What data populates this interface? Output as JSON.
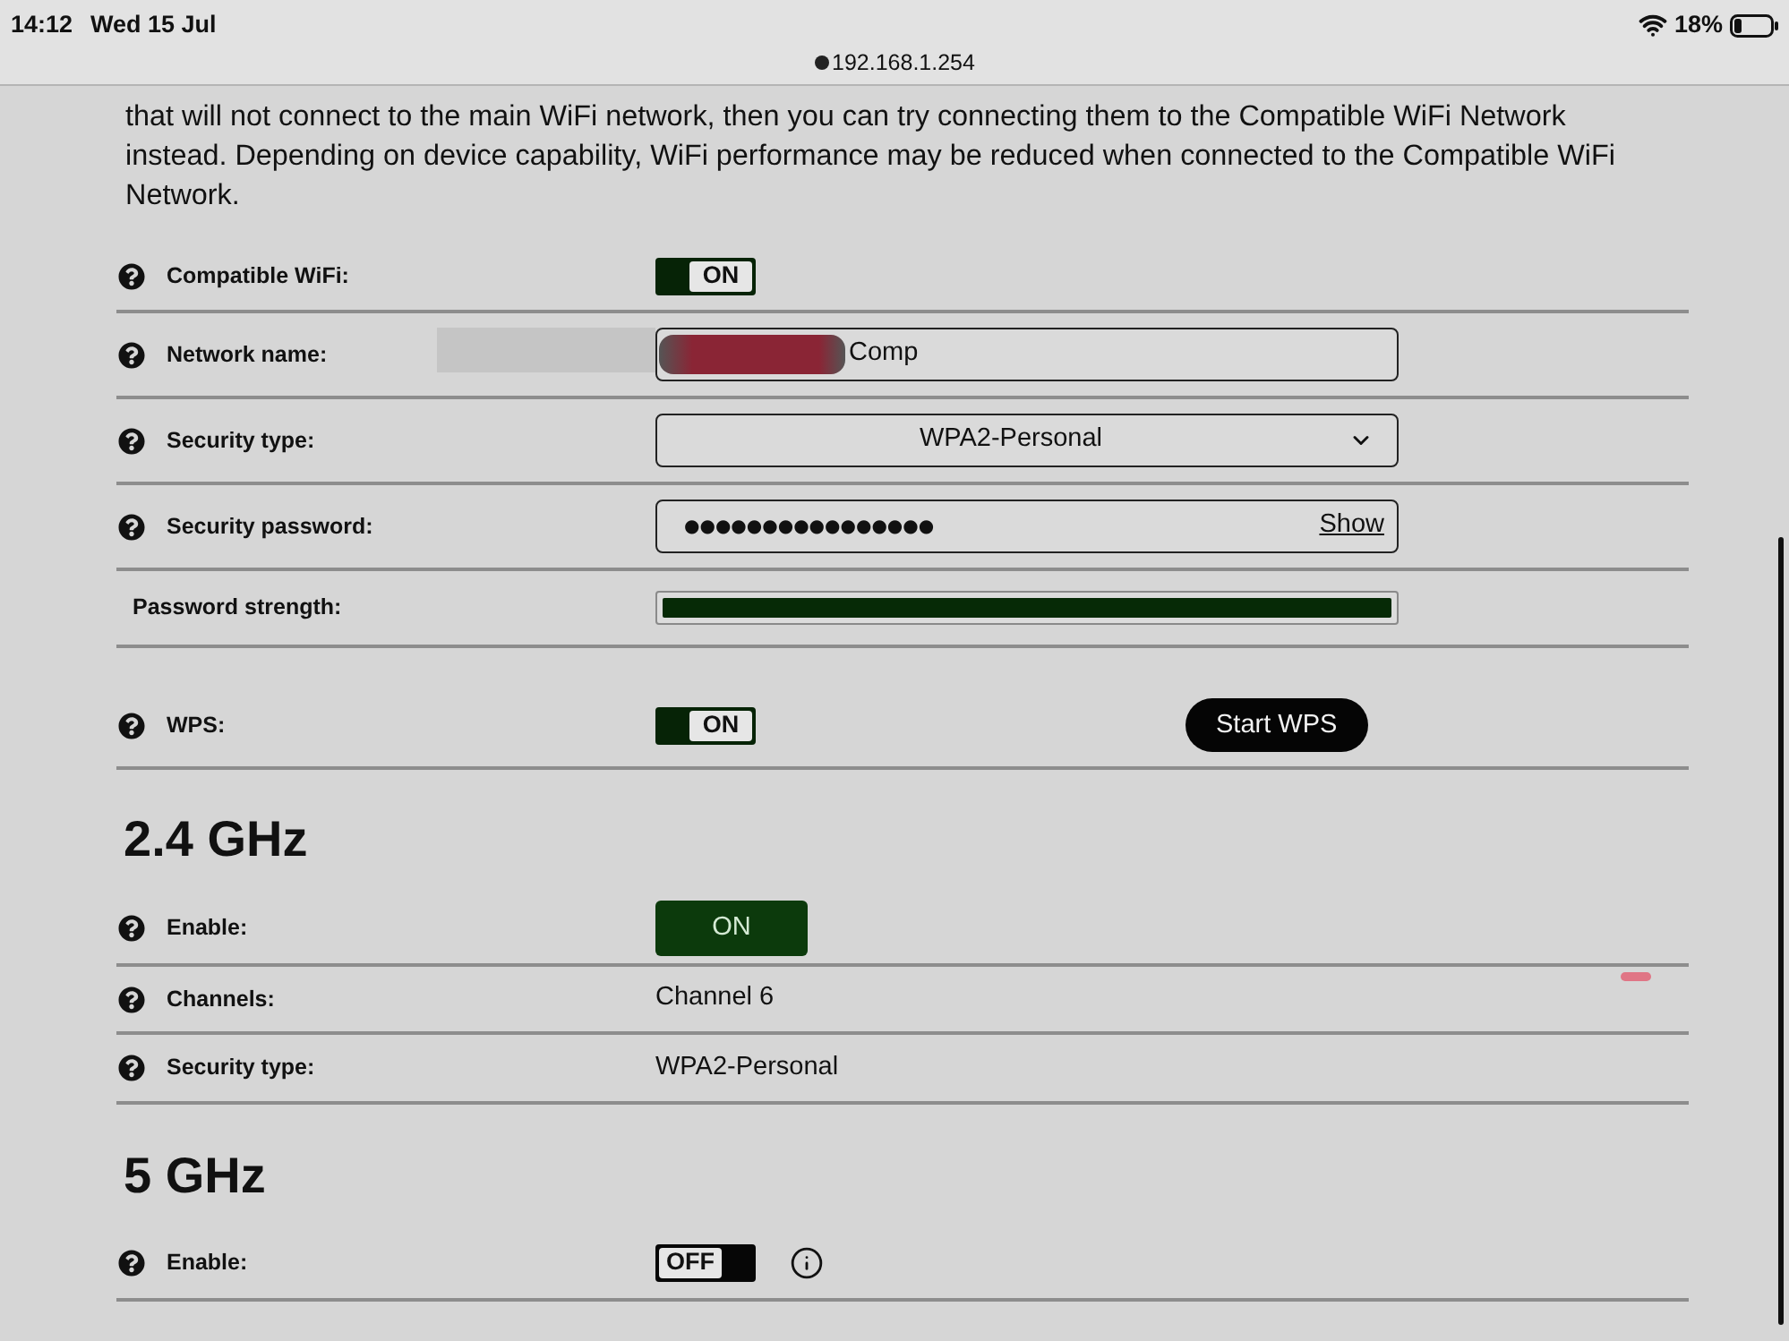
{
  "status_bar": {
    "time": "14:12",
    "date": "Wed 15 Jul",
    "url": "192.168.1.254",
    "battery": "18%"
  },
  "description": "that will not connect to the main WiFi network, then you can try connecting them to the Compatible WiFi Network instead. Depending on device capability, WiFi performance may be reduced when connected to the Compatible WiFi Network.",
  "rows": [
    {
      "kind": "toggle",
      "help": true,
      "label": "Compatible WiFi:",
      "toggle": {
        "text": "ON",
        "on": true
      }
    },
    {
      "kind": "text_field",
      "help": true,
      "label": "Network name:",
      "value": "Comp",
      "redacted": true
    },
    {
      "kind": "select",
      "help": true,
      "label": "Security type:",
      "value": "WPA2-Personal"
    },
    {
      "kind": "password",
      "help": true,
      "label": "Security password:",
      "value": "●●●●●●●●●●●●●●●●",
      "action": "Show"
    },
    {
      "kind": "meter",
      "help": false,
      "label": "Password strength:",
      "level": 1.0
    },
    {
      "kind": "toggle",
      "help": true,
      "label": "WPS:",
      "toggle": {
        "text": "ON",
        "on": true
      },
      "button": "Start WPS"
    }
  ],
  "sections": [
    {
      "title": "2.4 GHz",
      "rows": [
        {
          "kind": "button_toggle",
          "help": true,
          "label": "Enable:",
          "text": "ON",
          "on": true
        },
        {
          "kind": "text",
          "help": true,
          "label": "Channels:",
          "value": "Channel 6"
        },
        {
          "kind": "text",
          "help": true,
          "label": "Security type:",
          "value": "WPA2-Personal"
        }
      ]
    },
    {
      "title": "5 GHz",
      "rows": [
        {
          "kind": "toggle",
          "help": true,
          "label": "Enable:",
          "toggle": {
            "text": "OFF",
            "on": false
          },
          "info": true
        }
      ]
    }
  ]
}
